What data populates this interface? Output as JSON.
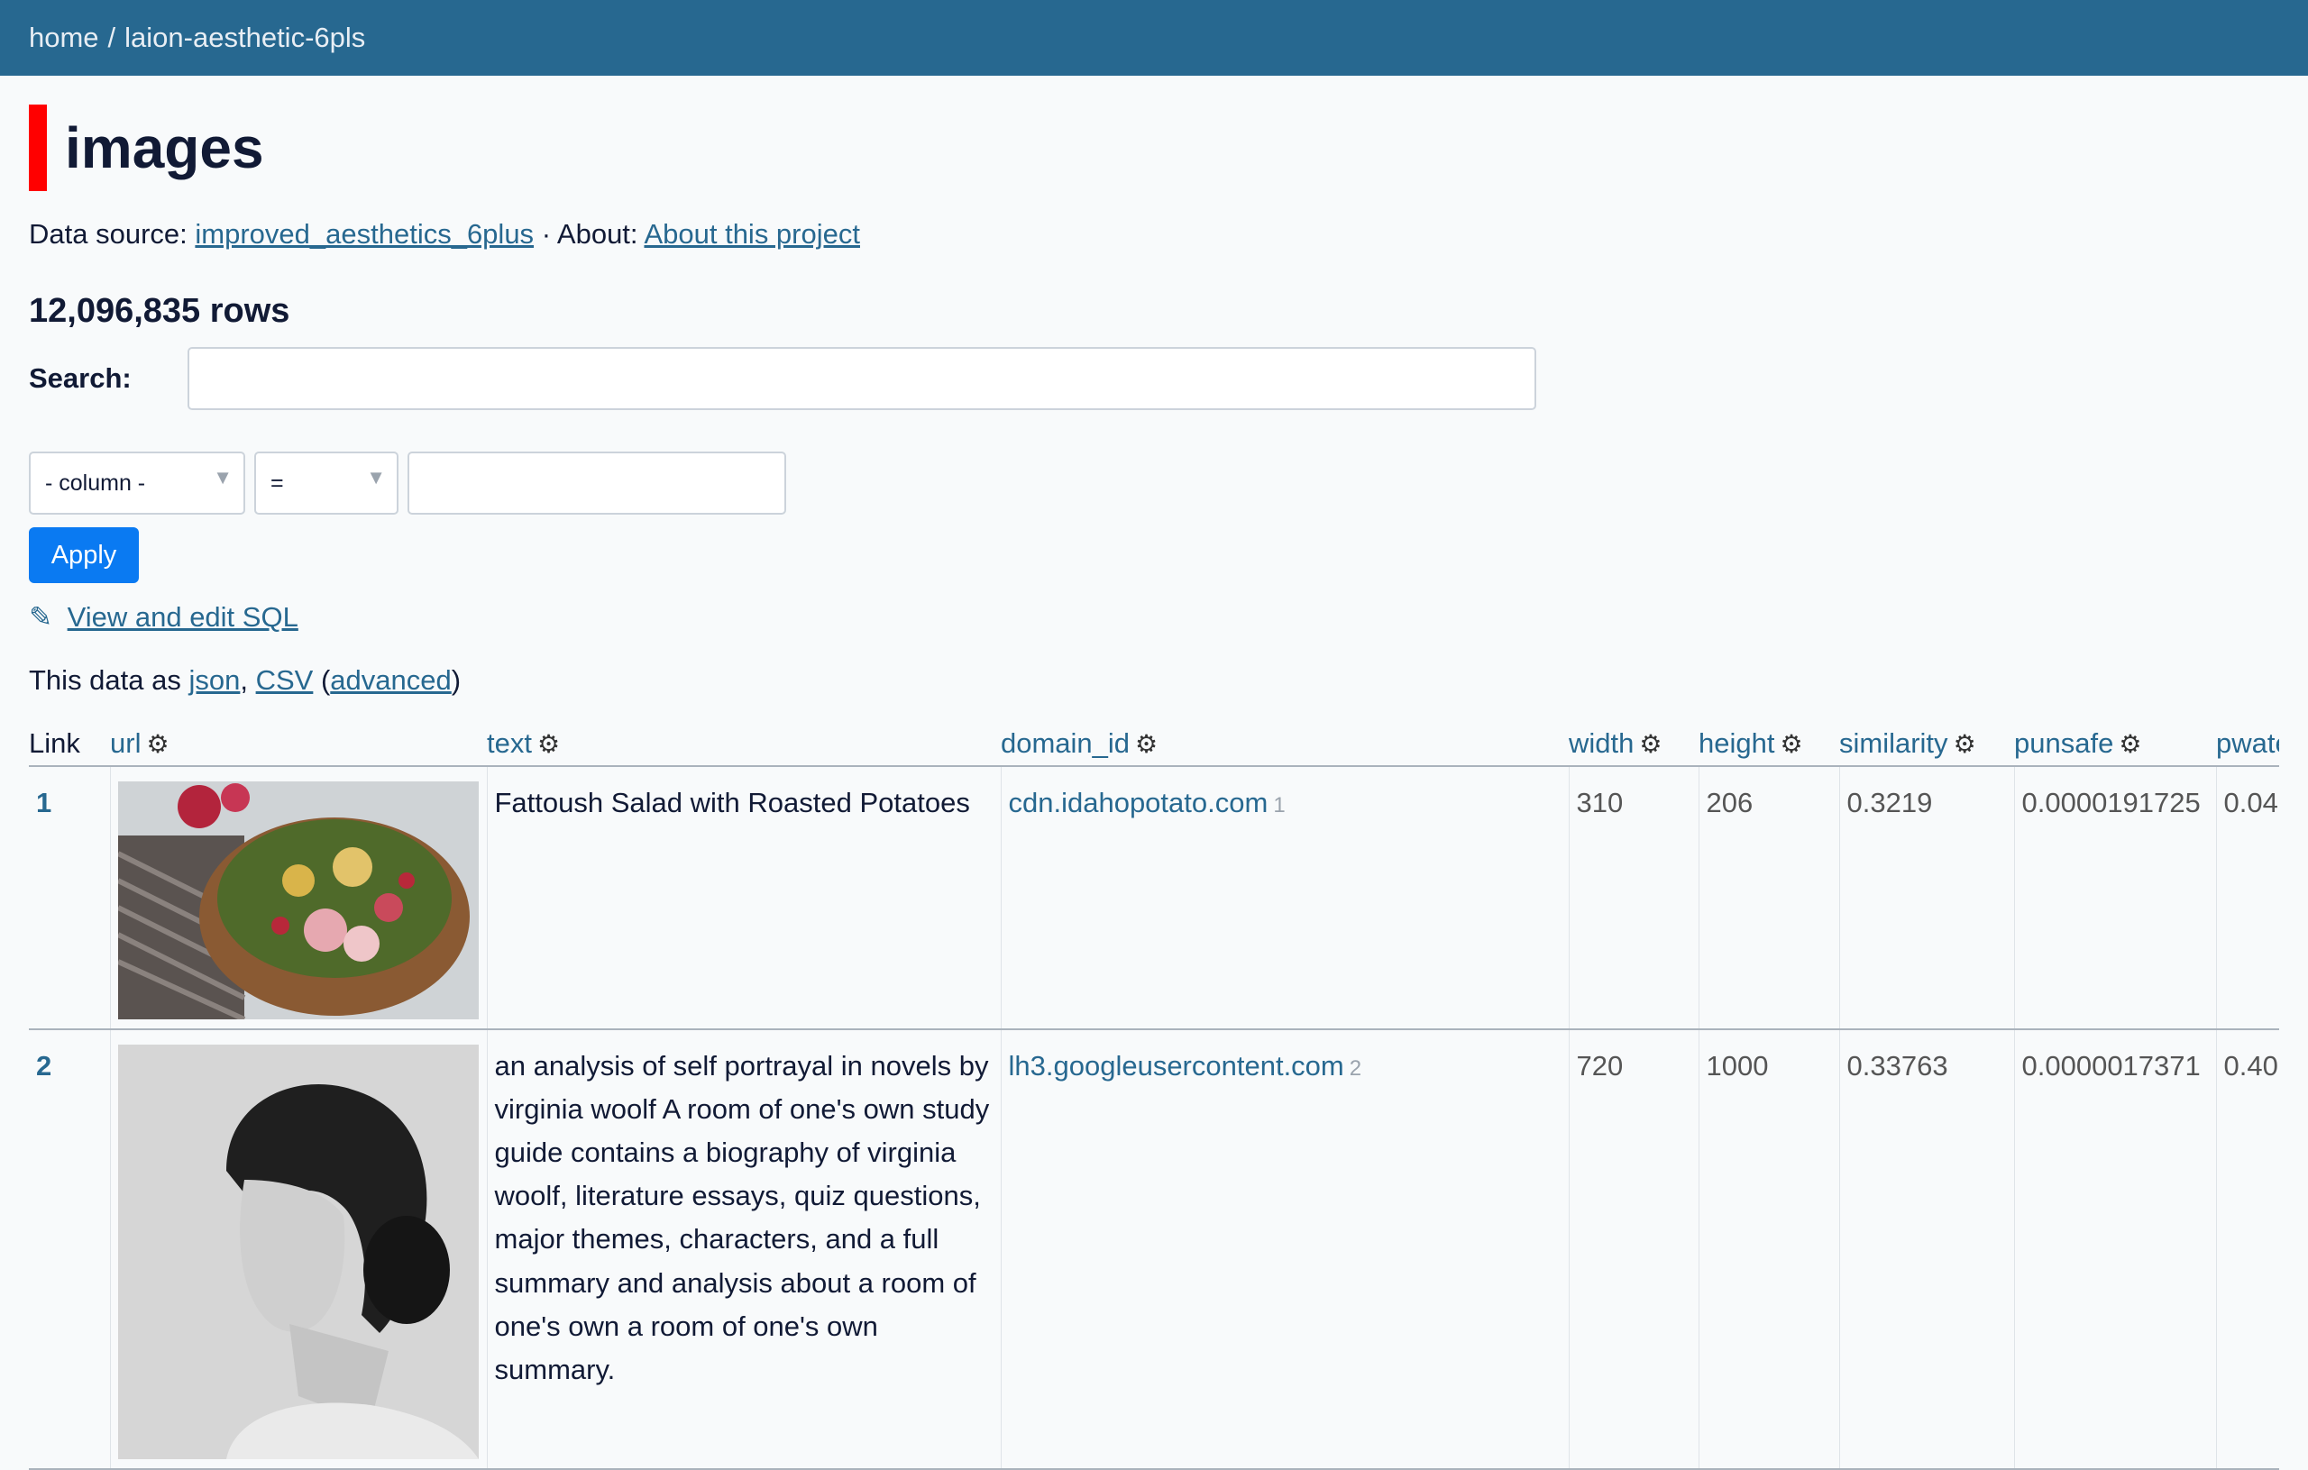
{
  "breadcrumb": {
    "home": "home",
    "separator": "/",
    "database": "laion-aesthetic-6pls"
  },
  "page": {
    "title": "images",
    "source_prefix": "Data source:",
    "source_link": "improved_aesthetics_6plus",
    "about_prefix": "· About:",
    "about_link": "About this project",
    "row_count": "12,096,835 rows"
  },
  "search": {
    "label": "Search:",
    "value": "",
    "placeholder": ""
  },
  "filter": {
    "column": "- column -",
    "operator": "=",
    "value": "",
    "apply_label": "Apply"
  },
  "sql_link": "View and edit SQL",
  "export": {
    "prefix": "This data as",
    "json": "json",
    "csv": "CSV",
    "advanced": "advanced"
  },
  "table": {
    "columns": [
      "Link",
      "url",
      "text",
      "domain_id",
      "width",
      "height",
      "similarity",
      "punsafe",
      "pwatermark"
    ],
    "rows": [
      {
        "link": "1",
        "image": "salad-photo",
        "text": "Fattoush Salad with Roasted Potatoes",
        "domain": "cdn.idahopotato.com",
        "domain_id": "1",
        "width": "310",
        "height": "206",
        "similarity": "0.3219",
        "punsafe": "0.0000191725",
        "pwatermark": "0.04"
      },
      {
        "link": "2",
        "image": "portrait-photo",
        "text": "an analysis of self portrayal in novels by virginia woolf A room of one's own study guide contains a biography of virginia woolf, literature essays, quiz questions, major themes, characters, and a full summary and analysis about a room of one's own a room of one's own summary.",
        "domain": "lh3.googleusercontent.com",
        "domain_id": "2",
        "width": "720",
        "height": "1000",
        "similarity": "0.33763",
        "punsafe": "0.0000017371",
        "pwatermark": "0.40"
      }
    ]
  }
}
